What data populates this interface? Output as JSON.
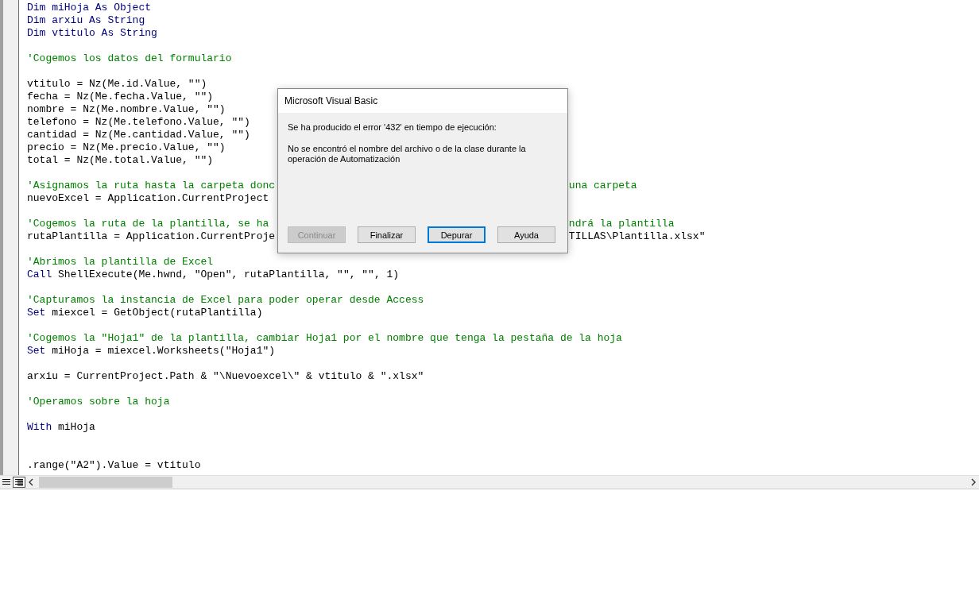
{
  "code_lines": [
    {
      "kind": "code",
      "segments": [
        {
          "kind": "keyword",
          "text": "Dim miHoja As Object"
        }
      ]
    },
    {
      "kind": "code",
      "segments": [
        {
          "kind": "keyword",
          "text": "Dim arxiu As String"
        }
      ]
    },
    {
      "kind": "code",
      "segments": [
        {
          "kind": "keyword",
          "text": "Dim vtitulo As String"
        }
      ]
    },
    {
      "kind": "blank"
    },
    {
      "kind": "code",
      "segments": [
        {
          "kind": "comment",
          "text": "'Cogemos los datos del formulario"
        }
      ]
    },
    {
      "kind": "blank"
    },
    {
      "kind": "code",
      "segments": [
        {
          "kind": "plain",
          "text": "vtitulo = Nz(Me.id.Value, \"\")"
        }
      ]
    },
    {
      "kind": "code",
      "segments": [
        {
          "kind": "plain",
          "text": "fecha = Nz(Me.fecha.Value, \"\")"
        }
      ]
    },
    {
      "kind": "code",
      "segments": [
        {
          "kind": "plain",
          "text": "nombre = Nz(Me.nombre.Value, \"\")"
        }
      ]
    },
    {
      "kind": "code",
      "segments": [
        {
          "kind": "plain",
          "text": "telefono = Nz(Me.telefono.Value, \"\")"
        }
      ]
    },
    {
      "kind": "code",
      "segments": [
        {
          "kind": "plain",
          "text": "cantidad = Nz(Me.cantidad.Value, \"\")"
        }
      ]
    },
    {
      "kind": "code",
      "segments": [
        {
          "kind": "plain",
          "text": "precio = Nz(Me.precio.Value, \"\")"
        }
      ]
    },
    {
      "kind": "code",
      "segments": [
        {
          "kind": "plain",
          "text": "total = Nz(Me.total.Value, \"\")"
        }
      ]
    },
    {
      "kind": "blank"
    },
    {
      "kind": "code",
      "segments": [
        {
          "kind": "comment",
          "text": "'Asignamos la ruta hasta la carpeta donc"
        }
      ],
      "right_segments": [
        {
          "kind": "comment",
          "text": "una carpeta"
        }
      ]
    },
    {
      "kind": "code",
      "segments": [
        {
          "kind": "plain",
          "text": "nuevoExcel = Application.CurrentProject"
        }
      ]
    },
    {
      "kind": "blank"
    },
    {
      "kind": "code",
      "segments": [
        {
          "kind": "comment",
          "text": "'Cogemos la ruta de la plantilla, se ha"
        }
      ],
      "right_segments": [
        {
          "kind": "comment",
          "text": "ndrá la plantilla"
        }
      ]
    },
    {
      "kind": "code",
      "segments": [
        {
          "kind": "plain",
          "text": "rutaPlantilla = Application.CurrentProje"
        }
      ],
      "right_segments": [
        {
          "kind": "plain",
          "text": "TILLAS\\Plantilla.xlsx\""
        }
      ]
    },
    {
      "kind": "blank"
    },
    {
      "kind": "code",
      "segments": [
        {
          "kind": "comment",
          "text": "'Abrimos la plantilla de Excel"
        }
      ]
    },
    {
      "kind": "code",
      "segments": [
        {
          "kind": "keyword",
          "text": "Call"
        },
        {
          "kind": "plain",
          "text": " ShellExecute(Me.hwnd, \"Open\", rutaPlantilla, \"\", \"\", 1)"
        }
      ]
    },
    {
      "kind": "blank"
    },
    {
      "kind": "code",
      "segments": [
        {
          "kind": "comment",
          "text": "'Capturamos la instancia de Excel para poder operar desde Access"
        }
      ]
    },
    {
      "kind": "code",
      "segments": [
        {
          "kind": "keyword",
          "text": "Set"
        },
        {
          "kind": "plain",
          "text": " miexcel = GetObject(rutaPlantilla)"
        }
      ]
    },
    {
      "kind": "blank"
    },
    {
      "kind": "code",
      "segments": [
        {
          "kind": "comment",
          "text": "'Cogemos la \"Hoja1\" de la plantilla, cambiar Hoja1 por el nombre que tenga la pestaña de la hoja"
        }
      ]
    },
    {
      "kind": "code",
      "segments": [
        {
          "kind": "keyword",
          "text": "Set"
        },
        {
          "kind": "plain",
          "text": " miHoja = miexcel.Worksheets(\"Hoja1\")"
        }
      ]
    },
    {
      "kind": "blank"
    },
    {
      "kind": "code",
      "segments": [
        {
          "kind": "plain",
          "text": "arxiu = CurrentProject.Path & \"\\Nuevoexcel\\\" & vtitulo & \".xlsx\""
        }
      ]
    },
    {
      "kind": "blank"
    },
    {
      "kind": "code",
      "segments": [
        {
          "kind": "comment",
          "text": "'Operamos sobre la hoja"
        }
      ]
    },
    {
      "kind": "blank"
    },
    {
      "kind": "code",
      "segments": [
        {
          "kind": "keyword",
          "text": "With"
        },
        {
          "kind": "plain",
          "text": " miHoja"
        }
      ]
    },
    {
      "kind": "blank"
    },
    {
      "kind": "blank"
    },
    {
      "kind": "code",
      "segments": [
        {
          "kind": "plain",
          "text": ".range(\"A2\").Value = vtitulo"
        }
      ]
    }
  ],
  "view_toggles": [
    {
      "kind": "procedure",
      "selected": false
    },
    {
      "kind": "module",
      "selected": true
    }
  ],
  "dialog": {
    "title": "Microsoft Visual Basic",
    "message": "Se ha producido el error '432' en tiempo de ejecución:",
    "detail": "No se encontró el nombre del archivo o de la clase durante la operación de Automatización",
    "buttons": [
      {
        "label": "Continuar",
        "disabled": true,
        "focused": false
      },
      {
        "label": "Finalizar",
        "disabled": false,
        "focused": false
      },
      {
        "label": "Depurar",
        "disabled": false,
        "focused": true
      },
      {
        "label": "Ayuda",
        "disabled": false,
        "focused": false
      }
    ]
  }
}
